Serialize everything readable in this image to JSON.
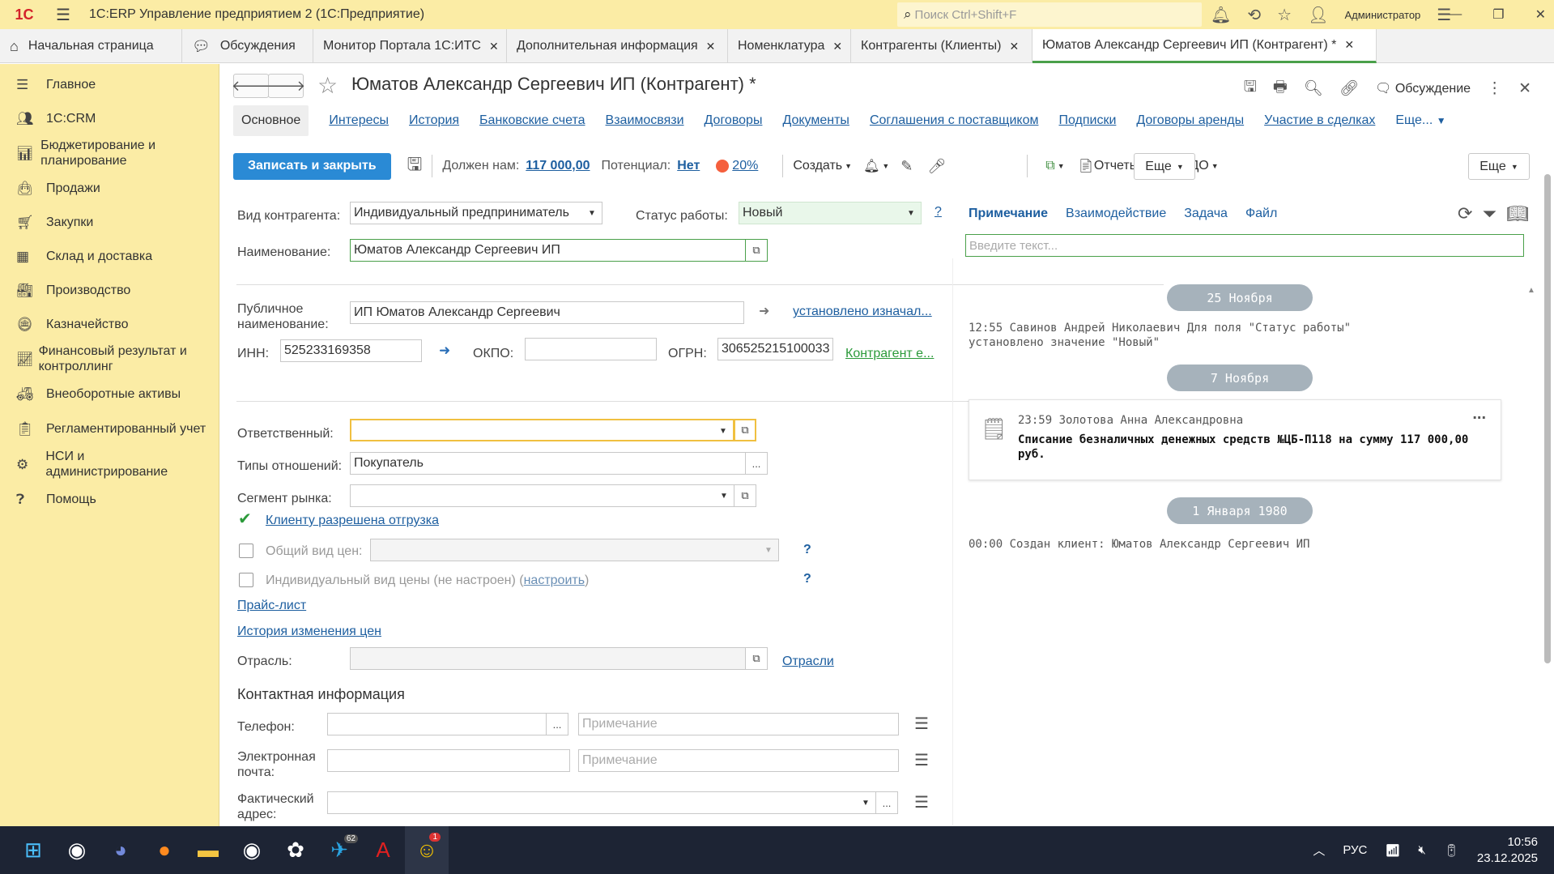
{
  "app": {
    "title": "1С:ERP Управление предприятием 2 (1С:Предприятие)",
    "logo": "1С",
    "search_placeholder": "Поиск Ctrl+Shift+F",
    "user": "Администратор"
  },
  "tabs": [
    {
      "label": "Начальная страница"
    },
    {
      "label": "Обсуждения"
    },
    {
      "label": "Монитор Портала 1С:ИТС"
    },
    {
      "label": "Дополнительная информация"
    },
    {
      "label": "Номенклатура"
    },
    {
      "label": "Контрагенты (Клиенты)"
    },
    {
      "label": "Юматов Александр Сергеевич ИП (Контрагент) *"
    }
  ],
  "sidebar": {
    "items": [
      {
        "label": "Главное",
        "icon": "menu-icon"
      },
      {
        "label": "1С:CRM",
        "icon": "crm-icon"
      },
      {
        "label": "Бюджетирование и планирование",
        "icon": "budget-icon"
      },
      {
        "label": "Продажи",
        "icon": "sales-icon"
      },
      {
        "label": "Закупки",
        "icon": "cart-icon"
      },
      {
        "label": "Склад и доставка",
        "icon": "warehouse-icon"
      },
      {
        "label": "Производство",
        "icon": "factory-icon"
      },
      {
        "label": "Казначейство",
        "icon": "treasury-icon"
      },
      {
        "label": "Финансовый результат и контроллинг",
        "icon": "chart-icon"
      },
      {
        "label": "Внеоборотные активы",
        "icon": "assets-icon"
      },
      {
        "label": "Регламентированный учет",
        "icon": "accounting-icon"
      },
      {
        "label": "НСИ и администрирование",
        "icon": "gear-icon"
      },
      {
        "label": "Помощь",
        "icon": "help-icon"
      }
    ]
  },
  "doc": {
    "title": "Юматов Александр Сергеевич ИП (Контрагент) *",
    "discuss": "Обсуждение",
    "section_tabs": [
      "Основное",
      "Интересы",
      "История",
      "Банковские счета",
      "Взаимосвязи",
      "Договоры",
      "Документы",
      "Соглашения с поставщиком",
      "Подписки",
      "Договоры аренды",
      "Участие в сделках",
      "Еще..."
    ]
  },
  "toolbar": {
    "save_close": "Записать и закрыть",
    "owes_label": "Должен нам:",
    "owes_value": "117 000,00",
    "potential_label": "Потенциал:",
    "potential_value": "Нет",
    "percent": "20%",
    "create": "Создать",
    "reports": "Отчеты",
    "edo": "ЭДО",
    "more1": "Еще",
    "more2": "Еще"
  },
  "form": {
    "kind_label": "Вид контрагента:",
    "kind_value": "Индивидуальный предприниматель",
    "status_label": "Статус работы:",
    "status_value": "Новый",
    "help": "?",
    "name_label": "Наименование:",
    "name_value": "Юматов Александр Сергеевич ИП",
    "public_label": "Публичное наименование:",
    "public_value": "ИП Юматов Александр Сергеевич",
    "public_link": "установлено изначал...",
    "inn_label": "ИНН:",
    "inn_value": "525233169358",
    "okpo_label": "ОКПО:",
    "okpo_value": "",
    "ogrn_label": "ОГРН:",
    "ogrn_value": "306525215100033",
    "kontragent_link": "Контрагент е...",
    "resp_label": "Ответственный:",
    "resp_value": "",
    "rel_label": "Типы отношений:",
    "rel_value": "Покупатель",
    "segment_label": "Сегмент рынка:",
    "segment_value": "",
    "shipping_link": "Клиенту разрешена отгрузка",
    "common_price_label": "Общий вид цен:",
    "indiv_price_label": "Индивидуальный вид цены (не настроен) (",
    "indiv_price_link": "настроить",
    "indiv_price_end": ")",
    "pricelist_link": "Прайс-лист",
    "price_history_link": "История изменения цен",
    "industry_label": "Отрасль:",
    "industry_link": "Отрасли",
    "contact_header": "Контактная информация",
    "phone_label": "Телефон:",
    "email_label": "Электронная почта:",
    "address_label": "Фактический адрес:",
    "note_placeholder": "Примечание",
    "dots": "..."
  },
  "right": {
    "tabs": [
      "Примечание",
      "Взаимодействие",
      "Задача",
      "Файл"
    ],
    "input_placeholder": "Введите текст...",
    "date1": "25 Ноября",
    "entry1": "12:55 Савинов Андрей Николаевич Для поля \"Статус работы\" установлено значение \"Новый\"",
    "date2": "7 Ноября",
    "card_header": "23:59 Золотова Анна Александровна",
    "card_text": "Списание безналичных денежных средств №ЦБ-П118 на сумму 117 000,00 руб.",
    "card_menu": "...",
    "date3": "1 Января 1980",
    "entry3": "00:00 Создан клиент: Юматов Александр Сергеевич ИП"
  },
  "taskbar": {
    "lang": "РУС",
    "time": "10:56",
    "date": "23.12.2025",
    "telegram_badge": "62",
    "app_badge": "1"
  },
  "colors": {
    "accent_yellow": "#fbeca5",
    "save_blue": "#2a8ad5",
    "link_blue": "#1e5fa0",
    "active_green": "#4aa04a",
    "status_bg": "#e9f7ea"
  }
}
